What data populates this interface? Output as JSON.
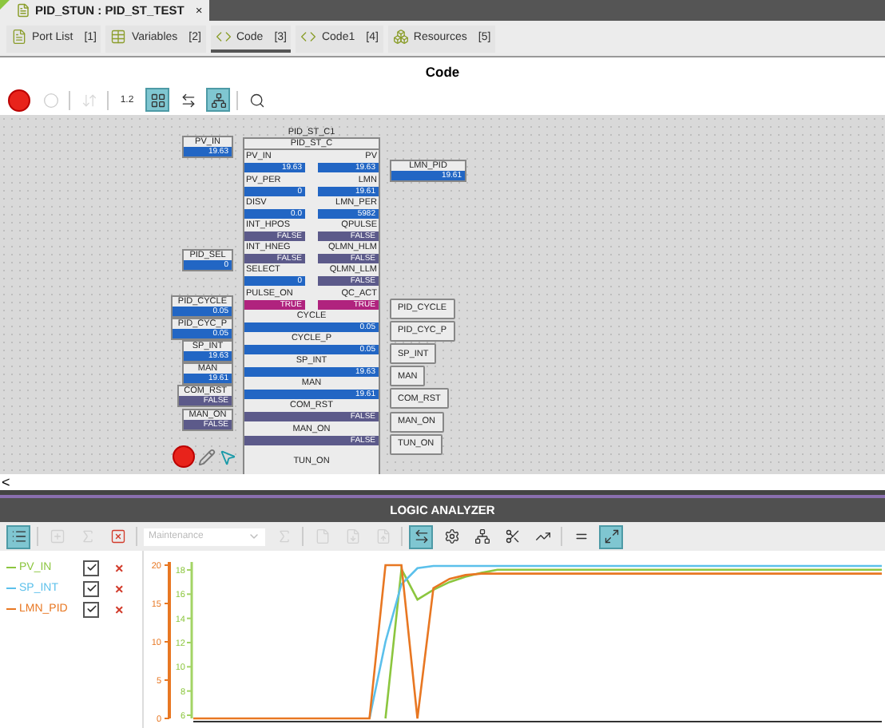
{
  "document_tab": {
    "title": "PID_STUN : PID_ST_TEST",
    "close": "×",
    "selected": true
  },
  "tabs": [
    {
      "label": "Port List",
      "key": "[1]",
      "kind": "list",
      "selected": false
    },
    {
      "label": "Variables",
      "key": "[2]",
      "kind": "table",
      "selected": false
    },
    {
      "label": "Code",
      "key": "[3]",
      "kind": "code",
      "selected": true
    },
    {
      "label": "Code1",
      "key": "[4]",
      "kind": "code",
      "selected": false
    },
    {
      "label": "Resources",
      "key": "[5]",
      "kind": "resources",
      "selected": false
    }
  ],
  "editor_title": "Code",
  "toolbar": {
    "groups": [
      [
        {
          "kind": "record",
          "active": false,
          "disabled": false
        },
        {
          "kind": "circle",
          "active": false,
          "disabled": false
        }
      ],
      [
        {
          "kind": "sort",
          "active": false,
          "disabled": true
        }
      ],
      [
        {
          "kind": "text",
          "label": "1.2",
          "active": false,
          "disabled": false
        },
        {
          "kind": "grid",
          "active": true,
          "disabled": false
        },
        {
          "kind": "connect",
          "active": false,
          "disabled": false
        },
        {
          "kind": "network",
          "active": true,
          "disabled": false
        }
      ],
      [
        {
          "kind": "search",
          "active": false,
          "disabled": false
        }
      ]
    ]
  },
  "block": {
    "instance": "PID_ST_C1",
    "type": "PID_ST_C",
    "rows": [
      {
        "left": {
          "name": "PV_IN",
          "value": "19.63",
          "kind": "number"
        },
        "right": {
          "name": "PV",
          "value": "19.63",
          "kind": "number"
        },
        "input": {
          "name": "PV_IN",
          "value": "19.63",
          "kind": "number"
        }
      },
      {
        "left": {
          "name": "PV_PER",
          "value": "0",
          "kind": "number"
        },
        "right": {
          "name": "LMN",
          "value": "19.61",
          "kind": "number"
        },
        "output": {
          "name": "LMN_PID",
          "value": "19.61",
          "kind": "number"
        }
      },
      {
        "left": {
          "name": "DISV",
          "value": "0.0",
          "kind": "number"
        },
        "right": {
          "name": "LMN_PER",
          "value": "5982",
          "kind": "number"
        }
      },
      {
        "left": {
          "name": "INT_HPOS",
          "value": "FALSE",
          "kind": "off"
        },
        "right": {
          "name": "QPULSE",
          "value": "FALSE",
          "kind": "off"
        }
      },
      {
        "left": {
          "name": "INT_HNEG",
          "value": "FALSE",
          "kind": "off"
        },
        "right": {
          "name": "QLMN_HLM",
          "value": "FALSE",
          "kind": "off"
        }
      },
      {
        "left": {
          "name": "SELECT",
          "value": "0",
          "kind": "number"
        },
        "right": {
          "name": "QLMN_LLM",
          "value": "FALSE",
          "kind": "off"
        },
        "input": {
          "name": "PID_SEL",
          "value": "0",
          "kind": "number"
        }
      },
      {
        "left": {
          "name": "PULSE_ON",
          "value": "TRUE",
          "kind": "on"
        },
        "right": {
          "name": "QC_ACT",
          "value": "TRUE",
          "kind": "on"
        }
      },
      {
        "inout": {
          "name": "CYCLE",
          "value": "0.05",
          "kind": "number"
        },
        "input": {
          "name": "PID_CYCLE",
          "value": "0.05",
          "kind": "number"
        },
        "output": {
          "name": "PID_CYCLE"
        }
      },
      {
        "inout": {
          "name": "CYCLE_P",
          "value": "0.05",
          "kind": "number"
        },
        "input": {
          "name": "PID_CYC_P",
          "value": "0.05",
          "kind": "number"
        },
        "output": {
          "name": "PID_CYC_P"
        }
      },
      {
        "inout": {
          "name": "SP_INT",
          "value": "19.63",
          "kind": "number"
        },
        "input": {
          "name": "SP_INT",
          "value": "19.63",
          "kind": "number"
        },
        "output": {
          "name": "SP_INT"
        }
      },
      {
        "inout": {
          "name": "MAN",
          "value": "19.61",
          "kind": "number"
        },
        "input": {
          "name": "MAN",
          "value": "19.61",
          "kind": "number"
        },
        "output": {
          "name": "MAN"
        }
      },
      {
        "inout": {
          "name": "COM_RST",
          "value": "FALSE",
          "kind": "off"
        },
        "input": {
          "name": "COM_RST",
          "value": "FALSE",
          "kind": "off"
        },
        "output": {
          "name": "COM_RST"
        }
      },
      {
        "inout": {
          "name": "MAN_ON",
          "value": "FALSE",
          "kind": "off"
        },
        "input": {
          "name": "MAN_ON",
          "value": "FALSE",
          "kind": "off"
        },
        "output": {
          "name": "MAN_ON"
        }
      },
      {
        "inout": {
          "name": "TUN_ON"
        },
        "output": {
          "name": "TUN_ON"
        }
      }
    ]
  },
  "scroll_arrow": "<",
  "analyzer": {
    "title": "LOGIC ANALYZER",
    "toolbar": {
      "groups": [
        [
          {
            "kind": "list",
            "active": true,
            "disabled": false
          }
        ],
        [
          {
            "kind": "add",
            "active": false,
            "disabled": true
          },
          {
            "kind": "function",
            "active": false,
            "disabled": true
          },
          {
            "kind": "remove",
            "active": false,
            "disabled": false
          }
        ],
        [
          {
            "kind": "dropdown",
            "label": "Maintenance",
            "disabled": true
          },
          {
            "kind": "function",
            "active": false,
            "disabled": true
          }
        ],
        [
          {
            "kind": "file",
            "active": false,
            "disabled": true
          },
          {
            "kind": "import",
            "active": false,
            "disabled": true
          },
          {
            "kind": "export",
            "active": false,
            "disabled": true
          }
        ],
        [
          {
            "kind": "fit",
            "active": true,
            "disabled": false
          },
          {
            "kind": "settings",
            "active": false,
            "disabled": false
          },
          {
            "kind": "network",
            "active": false,
            "disabled": false
          },
          {
            "kind": "cut",
            "active": false,
            "disabled": false
          },
          {
            "kind": "axis",
            "active": false,
            "disabled": false
          }
        ],
        [
          {
            "kind": "equal",
            "active": false,
            "disabled": false
          },
          {
            "kind": "expand",
            "active": true,
            "disabled": false
          }
        ]
      ]
    },
    "signals": [
      {
        "checked": true,
        "remove": "×"
      },
      {
        "checked": true,
        "remove": "×"
      },
      {
        "checked": true,
        "remove": "×"
      }
    ],
    "secondary_axis": {
      "ticks": [
        "18",
        "16",
        "14",
        "12",
        "10",
        "8",
        "6"
      ]
    },
    "chart_data": {
      "type": "line",
      "ylim": [
        0,
        20
      ],
      "yticks": [
        0,
        5,
        10,
        15,
        20
      ],
      "series": [
        {
          "name": "PV_IN",
          "color": "#8cc63f",
          "values": [
            null,
            null,
            null,
            null,
            null,
            null,
            null,
            null,
            null,
            null,
            null,
            null,
            0,
            19.5,
            15.5,
            16.8,
            17.8,
            18.5,
            19,
            19.4,
            19.4,
            19.4,
            19.4,
            19.4,
            19.4,
            19.4,
            19.4,
            19.4,
            19.4,
            19.4,
            19.4,
            19.4,
            19.4,
            19.4,
            19.4,
            19.4,
            19.4,
            19.4,
            19.4,
            19.4,
            19.4,
            19.4,
            19.4,
            19.4
          ]
        },
        {
          "name": "SP_INT",
          "color": "#5bc0eb",
          "values": [
            null,
            null,
            null,
            null,
            null,
            null,
            null,
            null,
            null,
            null,
            null,
            0,
            10,
            17.5,
            19.6,
            19.9,
            19.9,
            19.9,
            19.9,
            19.9,
            19.9,
            19.9,
            19.9,
            19.9,
            19.9,
            19.9,
            19.9,
            19.9,
            19.9,
            19.9,
            19.9,
            19.9,
            19.9,
            19.9,
            19.9,
            19.9,
            19.9,
            19.9,
            19.9,
            19.9,
            19.9,
            19.9,
            19.9,
            19.9
          ]
        },
        {
          "name": "LMN_PID",
          "color": "#e87722",
          "values": [
            0,
            0,
            0,
            0,
            0,
            0,
            0,
            0,
            0,
            0,
            0,
            0,
            20,
            20,
            0,
            17,
            18.2,
            18.7,
            18.9,
            18.9,
            18.9,
            18.9,
            18.9,
            18.9,
            18.9,
            18.9,
            18.9,
            18.9,
            18.9,
            18.9,
            18.9,
            18.9,
            18.9,
            18.9,
            18.9,
            18.9,
            18.9,
            18.9,
            18.9,
            18.9,
            18.9,
            18.9,
            18.9,
            18.9
          ]
        }
      ]
    }
  }
}
